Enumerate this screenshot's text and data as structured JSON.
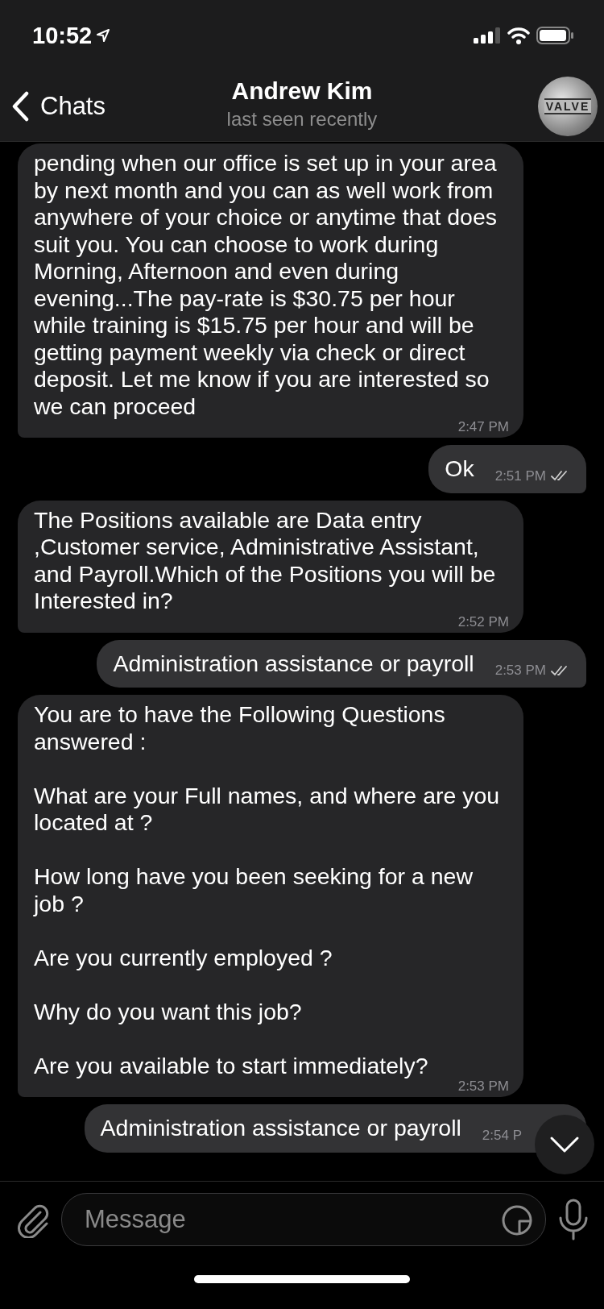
{
  "status_bar": {
    "time": "10:52"
  },
  "header": {
    "back_label": "Chats",
    "title": "Andrew Kim",
    "subtitle": "last seen recently",
    "avatar_text": "VALVE"
  },
  "messages": [
    {
      "kind": "incoming",
      "text": "pending when our office is set up in your area by next month and you can as well work from anywhere of your choice or anytime that does suit you. You can choose to work during Morning, Afternoon and even during evening...The pay-rate  is $30.75 per hour while training is $15.75 per hour and will be getting payment weekly via check or direct deposit. Let me know if you are interested so we can proceed",
      "time": "2:47 PM"
    },
    {
      "kind": "outgoing",
      "text": "Ok",
      "time": "2:51 PM",
      "read": true
    },
    {
      "kind": "incoming",
      "text": "The Positions available are Data entry ,Customer service, Administrative Assistant, and Payroll.Which of the Positions you will be Interested in?",
      "time": "2:52 PM"
    },
    {
      "kind": "outgoing",
      "text": "Administration assistance or payroll",
      "time": "2:53 PM",
      "read": true
    },
    {
      "kind": "incoming",
      "text": "You are to have the Following Questions answered :\n\nWhat are your Full names, and where are you located at ?\n\nHow long have  you been seeking for a new job ?\n\nAre you currently employed ?\n\nWhy do you want this job?\n\nAre you available to start immediately?",
      "time": "2:53 PM"
    },
    {
      "kind": "outgoing",
      "text": "Administration assistance or payroll",
      "time": "2:54 P"
    }
  ],
  "composer": {
    "placeholder": "Message"
  }
}
